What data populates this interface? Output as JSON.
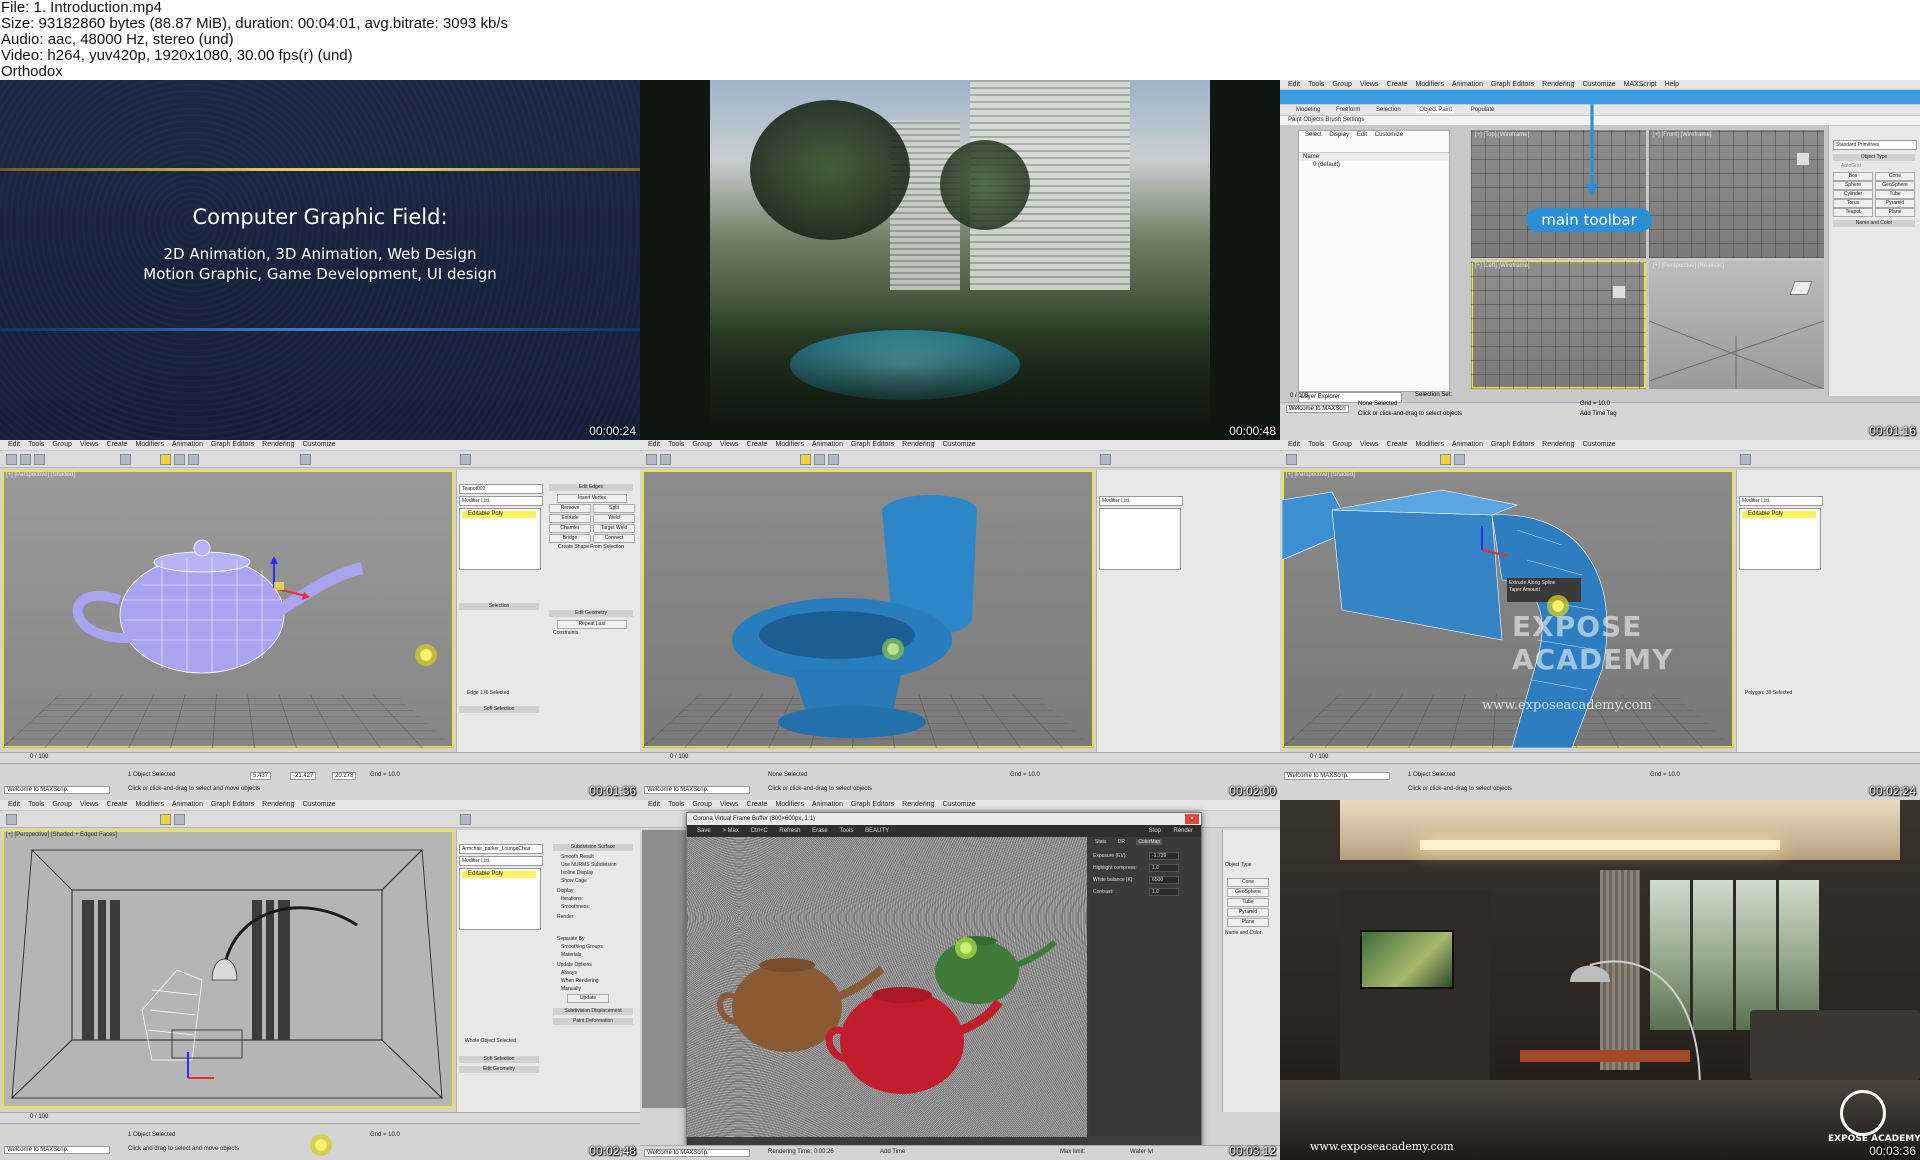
{
  "header": {
    "file": "File: 1. Introduction.mp4",
    "size": "Size: 93182860 bytes (88.87 MiB), duration: 00:04:01, avg.bitrate: 3093 kb/s",
    "audio": "Audio: aac, 48000 Hz, stereo (und)",
    "video": "Video: h264, yuv420p, 1920x1080, 30.00 fps(r) (und)",
    "author": "Orthodox"
  },
  "colors": {
    "max_selection_blue": "#2a8fd6",
    "viewport_active_yellow": "#e7e44c",
    "editable_poly_yellow": "#fff35a"
  },
  "max_menu": [
    "Edit",
    "Tools",
    "Group",
    "Views",
    "Create",
    "Modifiers",
    "Animation",
    "Graph Editors",
    "Rendering",
    "Customize",
    "MAXScript",
    "Help"
  ],
  "frames": [
    {
      "timestamp": "00:00:24",
      "title": "Computer Graphic Field:",
      "line1": "2D Animation, 3D Animation, Web Design",
      "line2": "Motion Graphic, Game Development, UI design"
    },
    {
      "timestamp": "00:00:48"
    },
    {
      "timestamp": "00:01:16",
      "ribbon_tabs": [
        "Modeling",
        "Freeform",
        "Selection",
        "Object Paint",
        "Populate"
      ],
      "ribbon_sub": "Paint Objects  Brush Settings",
      "explorer_tabs": [
        "Select",
        "Display",
        "Edit",
        "Customize"
      ],
      "explorer_col": "Name",
      "explorer_row": "0 (default)",
      "viewport_labels": [
        "[+] [Top] [Wireframe]",
        "[+] [Front] [Wireframe]",
        "[+] [Left] [Wireframe]",
        "[+] [Perspective] [Realistic]"
      ],
      "callout": "main toolbar",
      "panel": {
        "dropdown": "Standard Primitives",
        "rollout": "Object Type",
        "autogrid": "AutoGrid",
        "buttons": [
          "Box",
          "Cone",
          "Sphere",
          "GeoSphere",
          "Cylinder",
          "Tube",
          "Torus",
          "Pyramid",
          "Teapot",
          "Plane"
        ],
        "name_rollout": "Name and Color"
      },
      "layer": "Layer Explorer",
      "selection_set": "Selection Set:",
      "status": "None Selected",
      "prompt": "Click or click-and-drag to select objects",
      "grid": "Grid = 10.0",
      "add_time_tag": "Add Time Tag",
      "listener": "Welcome to MAXScri",
      "timeline": "0 / 100"
    },
    {
      "timestamp": "00:01:36",
      "viewport_label": "[+] [Perspective] [Shaded]",
      "object_name": "Teapot002",
      "modifier_list": "Modifier List",
      "stack_item": "Editable Poly",
      "rollouts": [
        "Edit Edges",
        "Insert Vertex",
        "Remove",
        "Split",
        "Extrude",
        "Weld",
        "Chamfer",
        "Target Weld",
        "Bridge",
        "Connect",
        "Create Shape From Selection",
        "Edit Geometry",
        "Repeat Last",
        "Constraints",
        "Selection",
        "Soft Selection"
      ],
      "status": "1 Object Selected",
      "prompt": "Click or click-and-drag to select and move objects",
      "coords": {
        "x": "5.437",
        "y": "-21.427",
        "z": "20.273"
      },
      "grid": "Grid = 10.0",
      "edge_count": "Edge 176 Selected",
      "listener": "Welcome to MAXScrip.",
      "timeline": "0 / 100"
    },
    {
      "timestamp": "00:02:00",
      "modifier_list": "Modifier List",
      "status": "None Selected",
      "prompt": "Click or click-and-drag to select objects",
      "grid": "Grid = 10.0",
      "listener": "Welcome to MAXScrip.",
      "timeline": "0 / 100"
    },
    {
      "timestamp": "00:02:24",
      "viewport_label": "[+] [Perspective] [Shaded]",
      "watermark_logo": "EXPOSE ACADEMY",
      "watermark_url": "www.exposeacademy.com",
      "tooltip": "Extrude Along Spline\nTaper Amount",
      "modifier_list": "Modifier List",
      "stack_item": "Editable Poly",
      "polygon_count": "Polygon: 39 Selected",
      "status": "1 Object Selected",
      "prompt": "Click or click-and-drag to select objects",
      "grid": "Grid = 10.0",
      "listener": "Welcome to MAXScrip.",
      "timeline": "0 / 100"
    },
    {
      "timestamp": "00:02:48",
      "viewport_label": "[+] [Perspective] [Shaded + Edged Faces]",
      "object_name": "Armchair_parker_LoungeChair",
      "modifier_list": "Modifier List",
      "stack_item": "Editable Poly",
      "rollouts": [
        "Subdivision Surface",
        "Smooth Result",
        "Use NURMS Subdivision",
        "Isoline Display",
        "Show Cage",
        "Display",
        "Iterations:",
        "Smoothness:",
        "Render",
        "Separate By",
        "Smoothing Groups",
        "Materials",
        "Update Options",
        "Always",
        "When Rendering",
        "Manually",
        "Update",
        "Subdivision Displacement",
        "Paint Deformation",
        "Soft Selection",
        "Edit Geometry"
      ],
      "selection_note": "Whole Object Selected",
      "status": "1 Object Selected",
      "prompt": "Click and drag to select and move objects",
      "grid": "Grid = 10.0",
      "listener": "Welcome to MAXScrip.",
      "timeline": "0 / 100"
    },
    {
      "timestamp": "00:03:12",
      "vfb_title": "Corona Virtual Frame Buffer (800×600px, 1:1)",
      "vfb_toolbar": [
        "Save",
        "> Max",
        "Ctrl+C",
        "Refresh",
        "Erase",
        "Tools",
        "BEAUTY"
      ],
      "vfb_stop": "Stop",
      "vfb_render": "Render",
      "vfb_tabs": [
        "Stats",
        "DR",
        "ColorMap"
      ],
      "vfb_params": [
        {
          "label": "Exposure (EV):",
          "value": "-1.739"
        },
        {
          "label": "Highlight compress:",
          "value": "1.0"
        },
        {
          "label": "White balance [K]:",
          "value": "6500"
        },
        {
          "label": "Contrast:",
          "value": "1.0"
        }
      ],
      "render_time": "Rendering Time: 0:00:26",
      "max_limit": "Max limit:",
      "water_lvl": "Water lvl",
      "add_time_tag": "Add Time",
      "listener": "Welcome to MAXScrip.",
      "panel_labels": [
        "Object Type",
        "Cone",
        "GeoSphere",
        "Tube",
        "Pyramid",
        "Plane",
        "Name and Color"
      ]
    },
    {
      "timestamp": "00:03:36",
      "watermark_url": "www.exposeacademy.com",
      "logo_text": "EXPOSE ACADEMY"
    }
  ]
}
